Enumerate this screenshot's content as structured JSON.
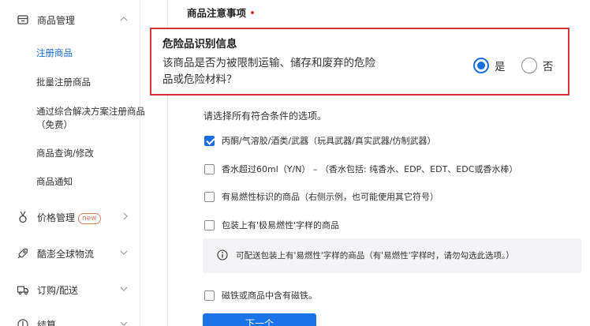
{
  "sidebar": {
    "groups": [
      {
        "label": "商品管理",
        "icon": "product-box-icon",
        "chevron": "up",
        "new_badge": ""
      },
      {
        "label": "价格管理",
        "icon": "price-medal-icon",
        "chevron": "right",
        "new_badge": "new"
      },
      {
        "label": "酷澎全球物流",
        "icon": "rocket-icon",
        "chevron": "down",
        "new_badge": ""
      },
      {
        "label": "订购/配送",
        "icon": "truck-icon",
        "chevron": "down",
        "new_badge": ""
      },
      {
        "label": "结算",
        "icon": "settlement-icon",
        "chevron": "down",
        "new_badge": ""
      }
    ],
    "items": [
      {
        "label": "注册商品",
        "active": true
      },
      {
        "label": "批量注册商品",
        "active": false
      },
      {
        "label": "通过综合解决方案注册商品",
        "active": false
      },
      {
        "label": "（免费）",
        "active": false
      },
      {
        "label": "商品查询/修改",
        "active": false
      },
      {
        "label": "商品通知",
        "active": false
      }
    ]
  },
  "main": {
    "section_title": "商品注意事项",
    "danger": {
      "title": "危险品识别信息",
      "question_line1": "该商品是否为被限制运输、储存和废弃的危险",
      "question_line2": "品或危险材料？",
      "options": [
        {
          "label": "是",
          "checked": true
        },
        {
          "label": "否",
          "checked": false
        }
      ]
    },
    "instruction": "请选择所有符合条件的选项。",
    "checkboxes": [
      {
        "label": "丙酮/气溶胶/酒类/武器（玩具武器/真实武器/仿制武器）",
        "checked": true
      },
      {
        "label": "香水超过60ml（Y/N） – （香水包括: 纯香水、EDP、EDT、EDC或香水棒）",
        "checked": false
      },
      {
        "label": "有易燃性标识的商品（右侧示例，也可能使用其它符号）",
        "checked": false
      },
      {
        "label": "包装上有'极易燃性'字样的商品",
        "checked": false
      },
      {
        "label": "磁铁或商品中含有磁铁。",
        "checked": false
      }
    ],
    "info_text": "可配送包装上有'易燃性'字样的商品（有'易燃性'字样时，请勿勾选此选项。）",
    "next_button": "下一个"
  },
  "colors": {
    "accent": "#1a6fe0",
    "danger_border": "#d0383d",
    "required": "#d9363e"
  }
}
